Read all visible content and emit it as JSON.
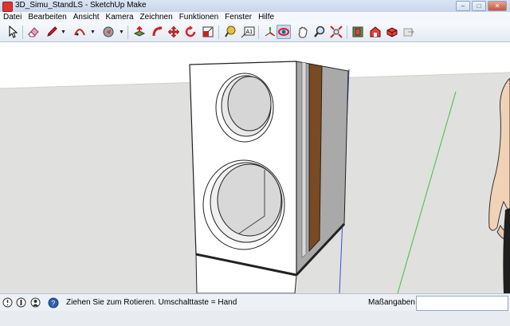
{
  "window": {
    "title": "3D_Simu_StandLS - SketchUp Make",
    "controls": [
      "minimize",
      "maximize",
      "close"
    ]
  },
  "menu": [
    "Datei",
    "Bearbeiten",
    "Ansicht",
    "Kamera",
    "Zeichnen",
    "Funktionen",
    "Fenster",
    "Hilfe"
  ],
  "toolbar": {
    "tools": [
      "select-icon",
      "eraser-icon",
      "pencil-icon",
      "arc-icon",
      "paint-bucket-icon",
      "push-pull-icon",
      "follow-me-icon",
      "move-icon",
      "rotate-icon",
      "scale-icon",
      "tape-measure-icon",
      "text-icon",
      "orbit-icon",
      "pan-icon",
      "zoom-icon",
      "zoom-extents-icon",
      "components-icon",
      "warehouse-icon",
      "extension-icon",
      "share-icon"
    ],
    "active_tool": "orbit-icon",
    "text_tool_glyph": "A1"
  },
  "viewport": {
    "sky_color": "#ffffff",
    "ground_color": "#e0e0de",
    "model": "speaker cabinet with two round drivers"
  },
  "status": {
    "message": "Ziehen Sie zum Rotieren.  Umschalttaste = Hand",
    "measurements_label": "Maßangaben",
    "measurements_value": ""
  }
}
